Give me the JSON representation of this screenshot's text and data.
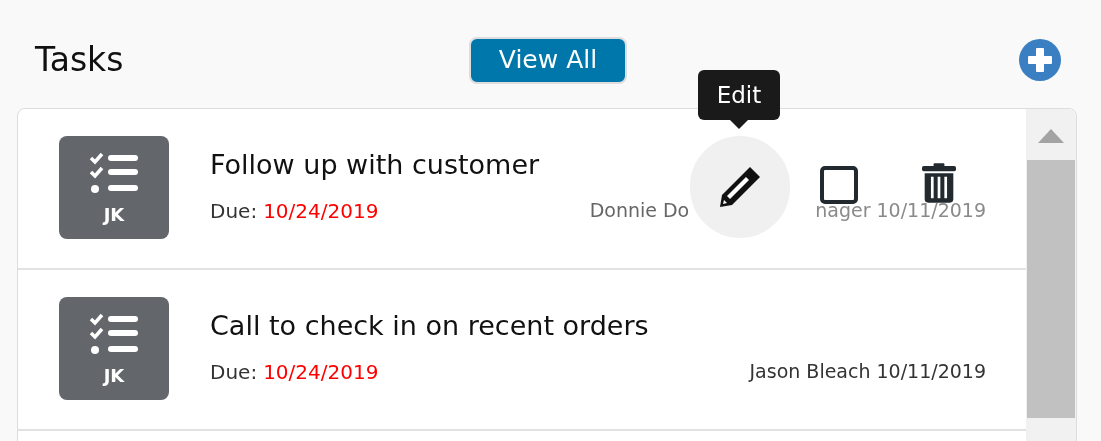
{
  "header": {
    "title": "Tasks",
    "view_all": "View All"
  },
  "tasks": [
    {
      "initials": "JK",
      "title": "Follow up with customer",
      "due_label": "Due:",
      "due_date": "10/24/2019",
      "meta_parts": [
        "Donnie Do",
        "nager 10/11/2019"
      ],
      "hovered": true,
      "tooltip": "Edit"
    },
    {
      "initials": "JK",
      "title": "Call to check in on recent orders",
      "due_label": "Due:",
      "due_date": "10/24/2019",
      "meta_parts": [
        "Jason Bleach 10/11/2019"
      ],
      "hovered": false
    }
  ]
}
